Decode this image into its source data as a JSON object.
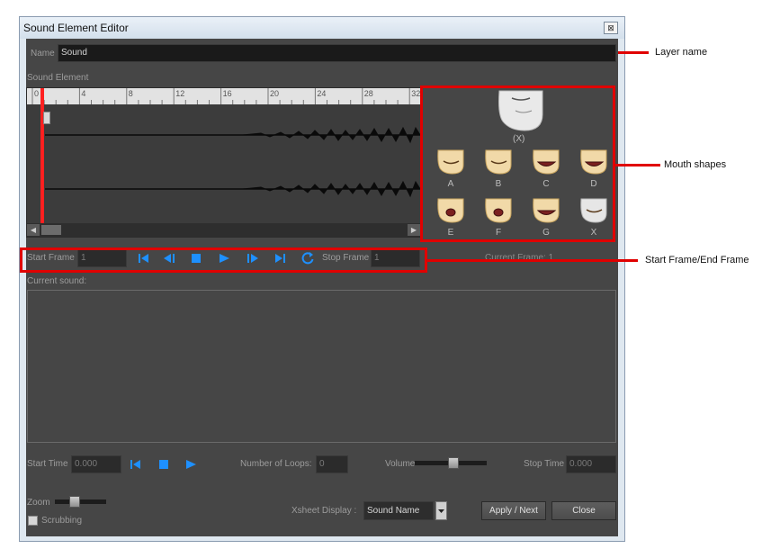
{
  "window": {
    "title": "Sound Element Editor",
    "close_glyph": "⊠"
  },
  "name_field": {
    "label": "Name",
    "value": "Sound"
  },
  "sound_element": {
    "label": "Sound Element",
    "ruler_ticks": [
      "0",
      "4",
      "8",
      "12",
      "16",
      "20",
      "24",
      "28",
      "32"
    ]
  },
  "mouth_shapes": {
    "current_label": "(X)",
    "shapes": [
      "A",
      "B",
      "C",
      "D",
      "E",
      "F",
      "G",
      "X"
    ]
  },
  "transport": {
    "start_frame_label": "Start Frame",
    "start_frame_value": "1",
    "stop_frame_label": "Stop Frame",
    "stop_frame_value": "1",
    "current_frame": "Current Frame: 1",
    "buttons": [
      "first-frame-icon",
      "previous-frame-icon",
      "stop-icon",
      "play-icon",
      "next-frame-icon",
      "last-frame-icon",
      "loop-icon"
    ]
  },
  "current_sound": {
    "label": "Current sound:"
  },
  "playback": {
    "start_time_label": "Start Time",
    "start_time_value": "0.000",
    "loops_label": "Number of Loops:",
    "loops_value": "0",
    "volume_label": "Volume",
    "volume_level": 0.55,
    "stop_time_label": "Stop Time",
    "stop_time_value": "0.000"
  },
  "zoom": {
    "label": "Zoom",
    "level": 0.35
  },
  "scrubbing": {
    "label": "Scrubbing",
    "checked": false
  },
  "xsheet": {
    "label": "Xsheet Display :",
    "value": "Sound Name"
  },
  "buttons": {
    "apply_next": "Apply / Next",
    "close": "Close"
  },
  "callouts": {
    "layer_name": "Layer name",
    "mouth_shapes": "Mouth shapes",
    "start_end_frame": "Start Frame/End Frame"
  },
  "colors": {
    "accent_blue": "#1e90ff",
    "highlight_red": "#e00000",
    "panel_gray": "#464646"
  }
}
